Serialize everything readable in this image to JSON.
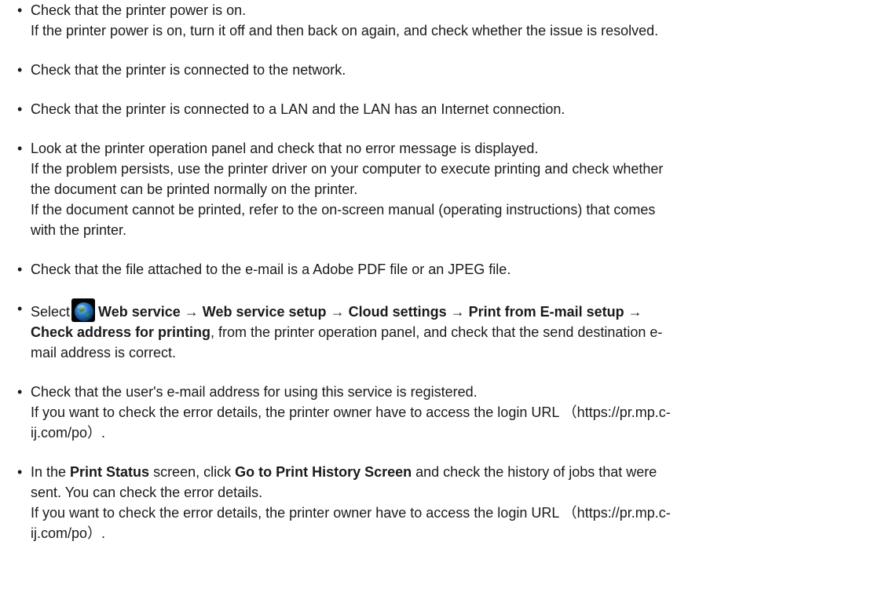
{
  "bullet_char": "•",
  "items": [
    {
      "lines": [
        "Check that the printer power is on.",
        "If the printer power is on, turn it off and then back on again, and check whether the issue is resolved."
      ]
    },
    {
      "lines": [
        "Check that the printer is connected to the network."
      ]
    },
    {
      "lines": [
        "Check that the printer is connected to a LAN and the LAN has an Internet connection."
      ]
    },
    {
      "lines": [
        "Look at the printer operation panel and check that no error message is displayed.",
        "If the problem persists, use the printer driver on your computer to execute printing and check whether",
        "the document can be printed normally on the printer.",
        "If the document cannot be printed, refer to the on-screen manual (operating instructions) that comes",
        "with the printer."
      ]
    },
    {
      "lines": [
        "Check that the file attached to the e-mail is a Adobe PDF file or an JPEG file."
      ]
    },
    {
      "select": {
        "prefix": "Select",
        "icon": "web-service-globe-icon",
        "path_1": "Web service",
        "arrow_1": "→",
        "path_2": "Web service setup",
        "arrow_2": "→",
        "path_3": "Cloud settings",
        "arrow_3": "→",
        "path_4": "Print from E-mail setup",
        "arrow_4": "→",
        "path_5": "Check address for printing",
        "rest_line2": ", from the printer operation panel, and check that the send destination e-",
        "line3": "mail address is correct."
      }
    },
    {
      "lines": [
        "Check that the user's e-mail address for using this service is registered.",
        "If you want to check the error details, the printer owner have to access the login URL （https://pr.mp.c-",
        "ij.com/po）."
      ]
    },
    {
      "status": {
        "in_the": "In the ",
        "print_status": "Print Status",
        "screen_click": " screen, click ",
        "go_to": "Go to Print History Screen",
        "rest_line1": " and check the history of jobs that were",
        "line2": "sent. You can check the error details.",
        "line3": "If you want to check the error details, the printer owner have to access the login URL （https://pr.mp.c-",
        "line4": "ij.com/po）."
      }
    }
  ]
}
